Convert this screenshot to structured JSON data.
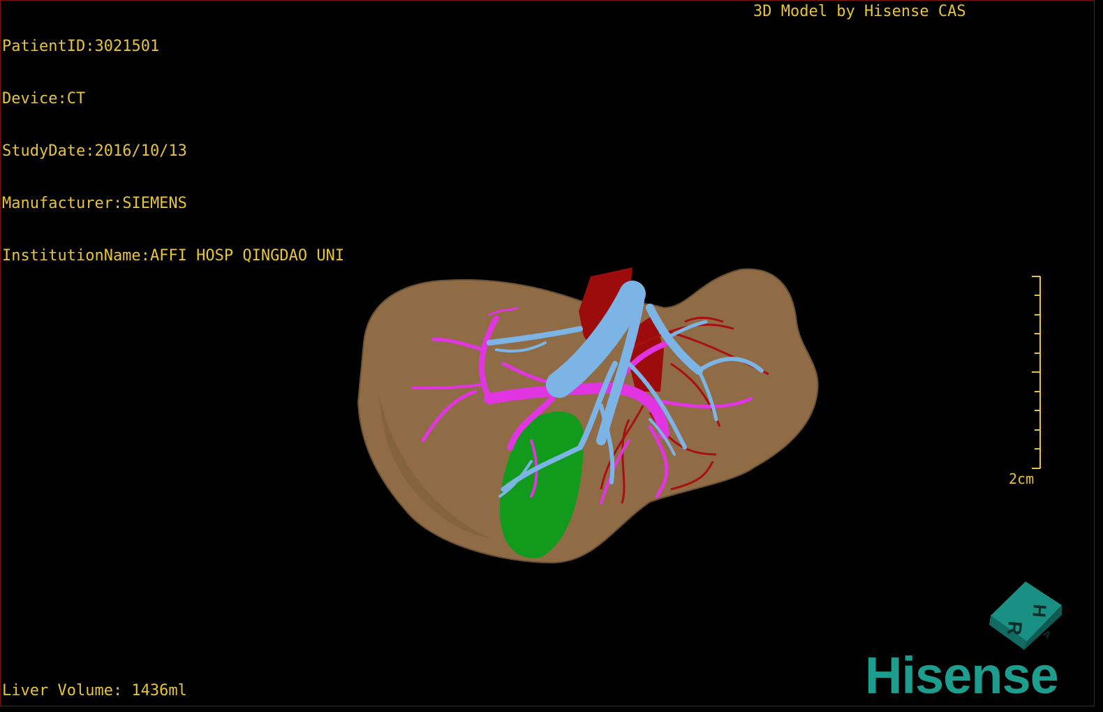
{
  "header_info": [
    {
      "label": "PatientID",
      "value": "3021501"
    },
    {
      "label": "Device",
      "value": "CT"
    },
    {
      "label": "StudyDate",
      "value": "2016/10/13"
    },
    {
      "label": "Manufacturer",
      "value": "SIEMENS"
    },
    {
      "label": "InstitutionName",
      "value": "AFFI HOSP QINGDAO UNI"
    }
  ],
  "credit": "3D Model by Hisense CAS",
  "volume_text": "Liver Volume: 1436ml",
  "scale_label": "2cm",
  "orientation_cube": {
    "face_labels": [
      "H",
      "R",
      "A"
    ],
    "color": "#1a8f84"
  },
  "logo_text": "Hisense",
  "colors": {
    "overlay_text": "#e8c43a",
    "liver": "#8f6c46",
    "gallbladder": "#129a1c",
    "hepatic_vein": "#7db4e6",
    "portal_vein": "#e035e0",
    "artery_ivc": "#9c0c0c",
    "logo": "#1c9d8d"
  },
  "structures": [
    "liver",
    "gallbladder",
    "hepatic-vein",
    "portal-vein",
    "hepatic-artery",
    "inferior-vena-cava"
  ]
}
